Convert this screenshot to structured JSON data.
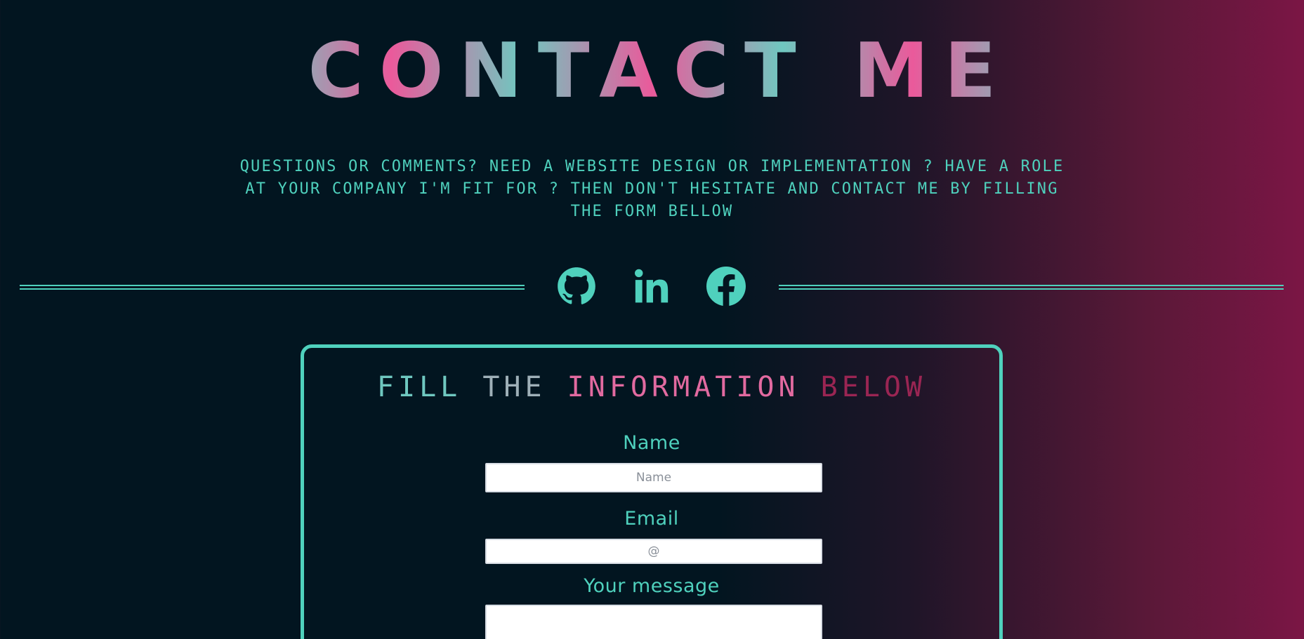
{
  "page": {
    "title": "CONTACT ME",
    "intro": "QUESTIONS OR COMMENTS? NEED A WEBSITE DESIGN OR IMPLEMENTATION ? HAVE A ROLE AT YOUR COMPANY I'M FIT  FOR ? THEN DON'T HESITATE AND CONTACT ME BY FILLING THE   FORM BELLOW"
  },
  "social": {
    "icons": [
      "github-icon",
      "linkedin-icon",
      "facebook-icon"
    ],
    "accent_color": "#4fd1bd"
  },
  "form": {
    "heading_words": [
      "FILL",
      "THE",
      "INFORMATION",
      "BELOW"
    ],
    "name_label": "Name",
    "name_placeholder": "Name",
    "email_label": "Email",
    "email_placeholder": "@",
    "message_label": "Your message",
    "message_placeholder": ""
  },
  "colors": {
    "accent": "#4fd1bd",
    "pink": "#e26aa0",
    "dark_bg": "#021520",
    "magenta_bg": "#7b1645"
  }
}
